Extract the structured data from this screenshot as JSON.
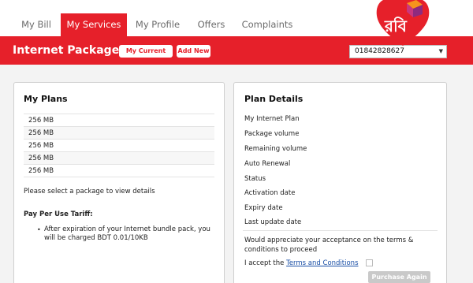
{
  "nav": {
    "tabs": [
      {
        "label": "My Bill"
      },
      {
        "label": "My Services"
      },
      {
        "label": "My Profile"
      },
      {
        "label": "Offers"
      },
      {
        "label": "Complaints"
      }
    ],
    "active_tab": "My Services"
  },
  "brand": {
    "logo_text": "রবি",
    "accent_color": "#e6202a"
  },
  "header": {
    "title": "Internet Packages",
    "my_current_plan_label": "My Current Plan",
    "add_new_label": "Add New",
    "number_select_value": "01842828627"
  },
  "plans": {
    "title": "My Plans",
    "items": [
      "256 MB",
      "256 MB",
      "256 MB",
      "256 MB",
      "256 MB"
    ],
    "select_prompt": "Please select a package to view details",
    "tariff_heading": "Pay Per Use Tariff:",
    "tariff_text": "After expiration of your Internet bundle pack, you will be charged BDT 0.01/10KB"
  },
  "details": {
    "title": "Plan Details",
    "fields": [
      "My Internet Plan",
      "Package volume",
      "Remaining volume",
      "Auto Renewal",
      "Status",
      "Activation date",
      "Expiry date",
      "Last update date"
    ],
    "terms_prompt": "Would appreciate your acceptance on the terms & conditions to proceed",
    "accept_label": "I accept the",
    "terms_link": "Terms and Conditions",
    "purchase_again_label": "Purchase Again"
  }
}
